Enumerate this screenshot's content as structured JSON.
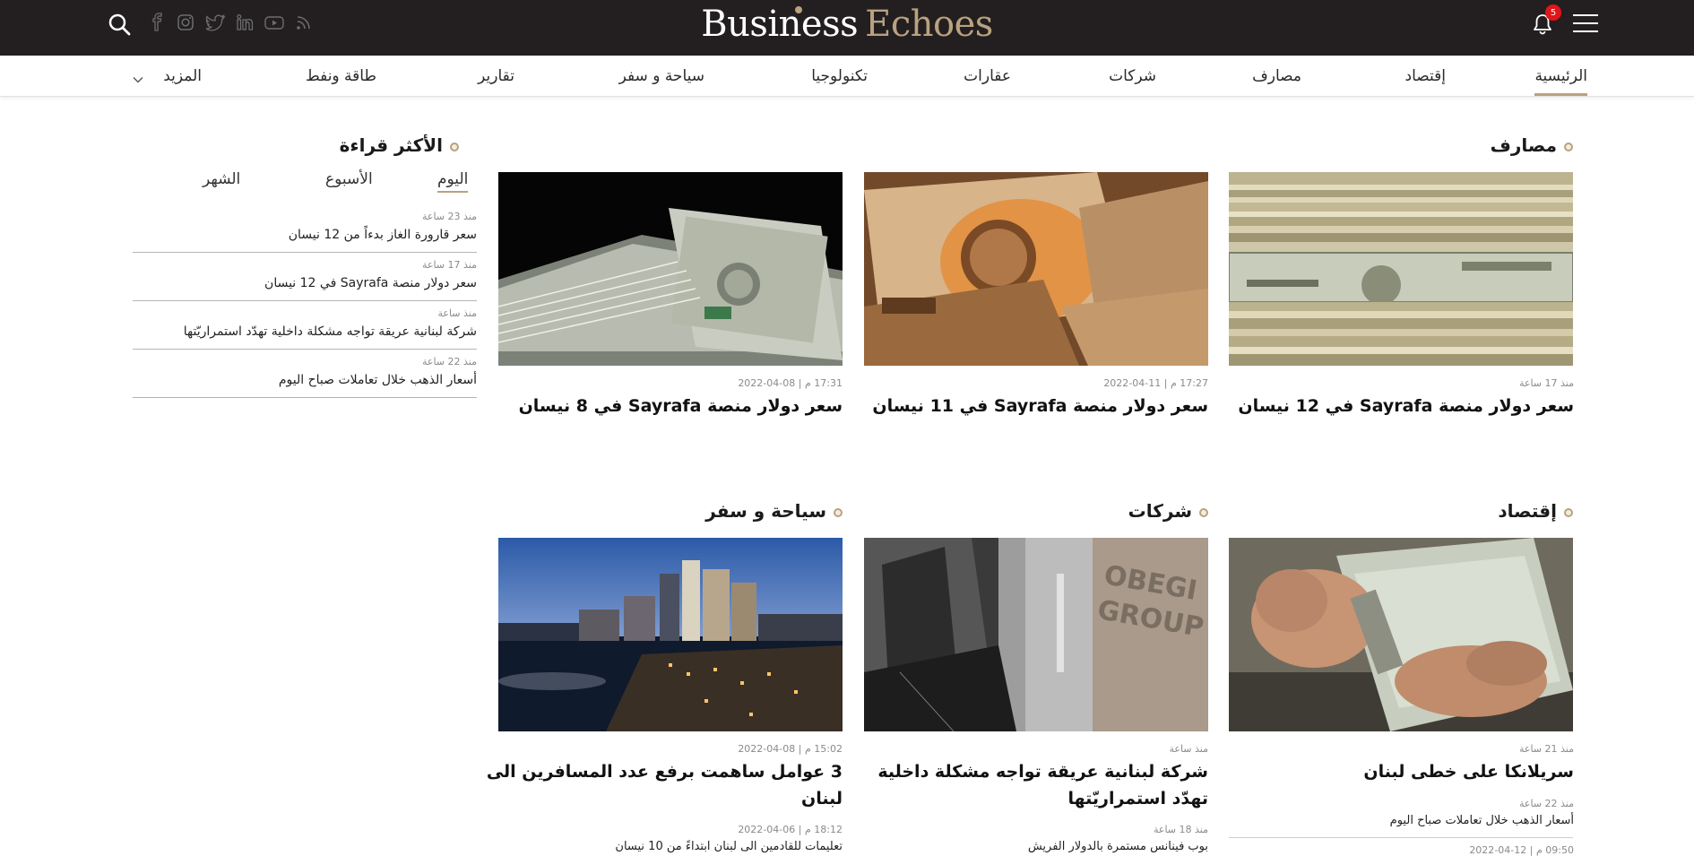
{
  "header": {
    "logo_part1": "Business",
    "logo_part2": "Echoes",
    "notification_count": "5",
    "colors": {
      "bar": "#231f20",
      "accent": "#b9a27f",
      "badge": "#e0161b"
    },
    "social_icons": [
      "rss-icon",
      "youtube-icon",
      "linkedin-icon",
      "twitter-icon",
      "instagram-icon",
      "facebook-icon"
    ]
  },
  "nav": {
    "items": [
      "الرئيسية",
      "إقتصاد",
      "مصارف",
      "شركات",
      "عقارات",
      "تكنولوجيا",
      "سياحة و سفر",
      "تقارير",
      "طاقة ونفط",
      "المزيد"
    ],
    "active": "الرئيسية"
  },
  "sections": {
    "banks": {
      "title": "مصارف",
      "cards": [
        {
          "time": "منذ 17 ساعة",
          "title": "سعر دولار منصة Sayrafa في 12 نيسان"
        },
        {
          "time": "17:27 م | 11-04-2022",
          "title": "سعر دولار منصة Sayrafa في 11 نيسان"
        },
        {
          "time": "17:31 م | 08-04-2022",
          "title": "سعر دولار منصة Sayrafa في 8 نيسان"
        }
      ]
    },
    "economy": {
      "title": "إقتصاد",
      "card": {
        "time": "منذ 21 ساعة",
        "title": "سريلانكا على خطى لبنان"
      },
      "sub": [
        {
          "time": "منذ 22 ساعة",
          "title": "أسعار الذهب خلال تعاملات صباح اليوم"
        },
        {
          "time": "09:50 م | 12-04-2022"
        }
      ]
    },
    "companies": {
      "title": "شركات",
      "card": {
        "time": "منذ ساعة",
        "title_line1": "شركة لبنانية عريقة تواجه مشكلة داخلية",
        "title_line2": "تهدّد استمراريّتها"
      },
      "sub": [
        {
          "time": "منذ 18 ساعة",
          "title": "بوب فينانس مستمرة بالدولار الفريش"
        }
      ]
    },
    "travel": {
      "title": "سياحة و سفر",
      "card": {
        "time": "15:02 م | 08-04-2022",
        "title_line1": "3 عوامل ساهمت برفع عدد المسافرين الى",
        "title_line2": "لبنان"
      },
      "sub": [
        {
          "time": "18:12 م | 06-04-2022",
          "title": "تعليمات للقادمين الى لبنان ابتداءً من 10 نيسان"
        }
      ]
    }
  },
  "most_read": {
    "title": "الأكثر قراءة",
    "tabs": [
      "اليوم",
      "الأسبوع",
      "الشهر"
    ],
    "active_tab": "اليوم",
    "items": [
      {
        "time": "منذ 23 ساعة",
        "title": "سعر قارورة الغاز بدءاً من 12 نيسان"
      },
      {
        "time": "منذ 17 ساعة",
        "title": "سعر دولار منصة Sayrafa في 12 نيسان"
      },
      {
        "time": "منذ ساعة",
        "title": "شركة لبنانية عريقة تواجه مشكلة داخلية تهدّد استمراريّتها"
      },
      {
        "time": "منذ 22 ساعة",
        "title": "أسعار الذهب خلال تعاملات صباح اليوم"
      }
    ]
  }
}
